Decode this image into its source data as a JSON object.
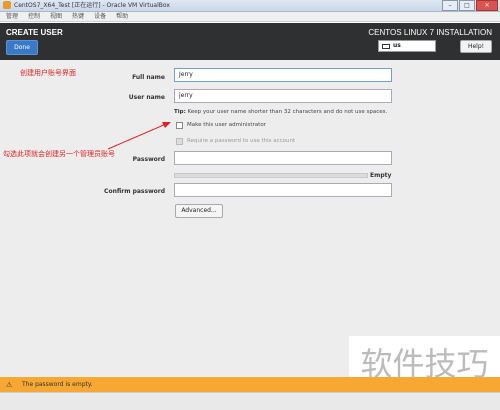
{
  "window": {
    "title": "CentOS7_X64_Test [正在运行] - Oracle VM VirtualBox",
    "min": "–",
    "max": "□",
    "close": "✕"
  },
  "menubar": [
    "管理",
    "控制",
    "视图",
    "热键",
    "设备",
    "帮助"
  ],
  "header": {
    "title": "CREATE USER",
    "done_label": "Done",
    "product": "CENTOS LINUX 7 INSTALLATION",
    "keyboard_layout": "us",
    "help_label": "Help!"
  },
  "form": {
    "full_name_label": "Full name",
    "full_name_value": "Jerry",
    "user_name_label": "User name",
    "user_name_value": "jerry",
    "tip_prefix": "Tip:",
    "tip_text": "Keep your user name shorter than 32 characters and do not use spaces.",
    "admin_checkbox_label": "Make this user administrator",
    "require_password_label": "Require a password to use this account",
    "password_label": "Password",
    "strength_label": "Empty",
    "confirm_password_label": "Confirm password",
    "advanced_label": "Advanced..."
  },
  "annotations": {
    "top": "创建用户账号界面",
    "middle": "勾选此项就会创建另一个管理员账号",
    "arrow_color": "#e02020"
  },
  "warning": {
    "icon": "warning-icon",
    "text": "The password is empty."
  },
  "watermark": "软件技巧"
}
